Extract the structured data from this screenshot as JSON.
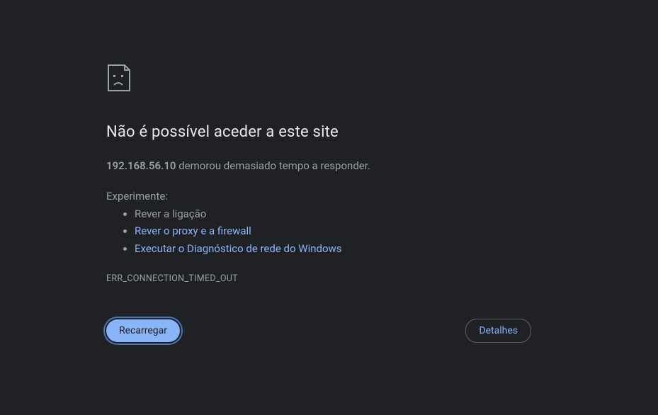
{
  "heading": "Não é possível aceder a este site",
  "host": "192.168.56.10",
  "sub_message": " demorou demasiado tempo a responder.",
  "try_label": "Experimente:",
  "suggestions": [
    {
      "text": "Rever a ligação",
      "link": false
    },
    {
      "text": "Rever o proxy e a firewall",
      "link": true
    },
    {
      "text": "Executar o Diagnóstico de rede do Windows",
      "link": true
    }
  ],
  "error_code": "ERR_CONNECTION_TIMED_OUT",
  "buttons": {
    "reload": "Recarregar",
    "details": "Detalhes"
  }
}
